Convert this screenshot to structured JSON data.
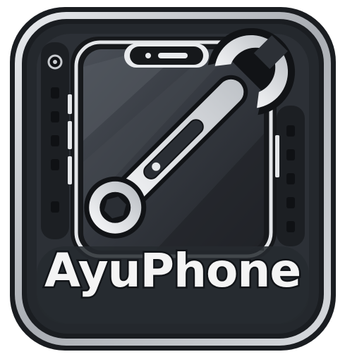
{
  "logo": {
    "brand_name": "AyuPhone",
    "icons": [
      "phone-icon",
      "wrench-icon"
    ],
    "colors": {
      "frame_outer": "#1a1d21",
      "frame_silver": "#c8cbcf",
      "panel_dark": "#2a2e34",
      "screen": "#3b3f46",
      "wrench": "#e6e8ea",
      "text": "#f4f4f4"
    }
  }
}
